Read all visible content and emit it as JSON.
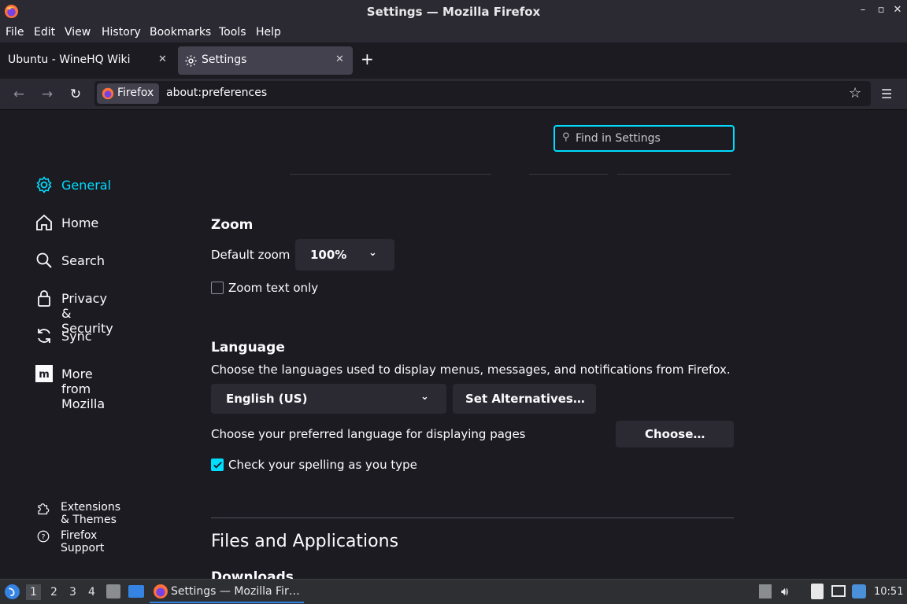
{
  "window": {
    "title": "Settings — Mozilla Firefox"
  },
  "menu": [
    "File",
    "Edit",
    "View",
    "History",
    "Bookmarks",
    "Tools",
    "Help"
  ],
  "tabs": [
    {
      "label": "Ubuntu - WineHQ Wiki",
      "active": false
    },
    {
      "label": "Settings",
      "active": true
    }
  ],
  "navbar": {
    "identity": "Firefox",
    "url": "about:preferences"
  },
  "search": {
    "placeholder": "Find in Settings"
  },
  "sidebar": {
    "items": [
      {
        "label": "General",
        "icon": "gear-icon",
        "selected": true
      },
      {
        "label": "Home",
        "icon": "home-icon"
      },
      {
        "label": "Search",
        "icon": "search-icon"
      },
      {
        "label": "Privacy & Security",
        "icon": "lock-icon"
      },
      {
        "label": "Sync",
        "icon": "sync-icon"
      },
      {
        "label": "More from Mozilla",
        "icon": "mozilla-icon"
      }
    ],
    "footer": [
      {
        "label": "Extensions & Themes",
        "icon": "puzzle-icon"
      },
      {
        "label": "Firefox Support",
        "icon": "help-icon"
      }
    ]
  },
  "zoom": {
    "heading": "Zoom",
    "default_label": "Default zoom",
    "default_value": "100%",
    "text_only_label": "Zoom text only",
    "text_only_checked": false
  },
  "language": {
    "heading": "Language",
    "description": "Choose the languages used to display menus, messages, and notifications from Firefox.",
    "selected": "English (US)",
    "alternatives_button": "Set Alternatives…",
    "pages_label": "Choose your preferred language for displaying pages",
    "choose_button": "Choose…",
    "spell_label": "Check your spelling as you type",
    "spell_checked": true
  },
  "files": {
    "heading": "Files and Applications",
    "downloads": "Downloads"
  },
  "taskbar": {
    "workspaces": [
      "1",
      "2",
      "3",
      "4"
    ],
    "app_label": "Settings — Mozilla Fir…",
    "clock": "10:51"
  },
  "colors": {
    "accent": "#00ddff",
    "bg": "#1c1b22",
    "surface": "#2b2a33"
  }
}
